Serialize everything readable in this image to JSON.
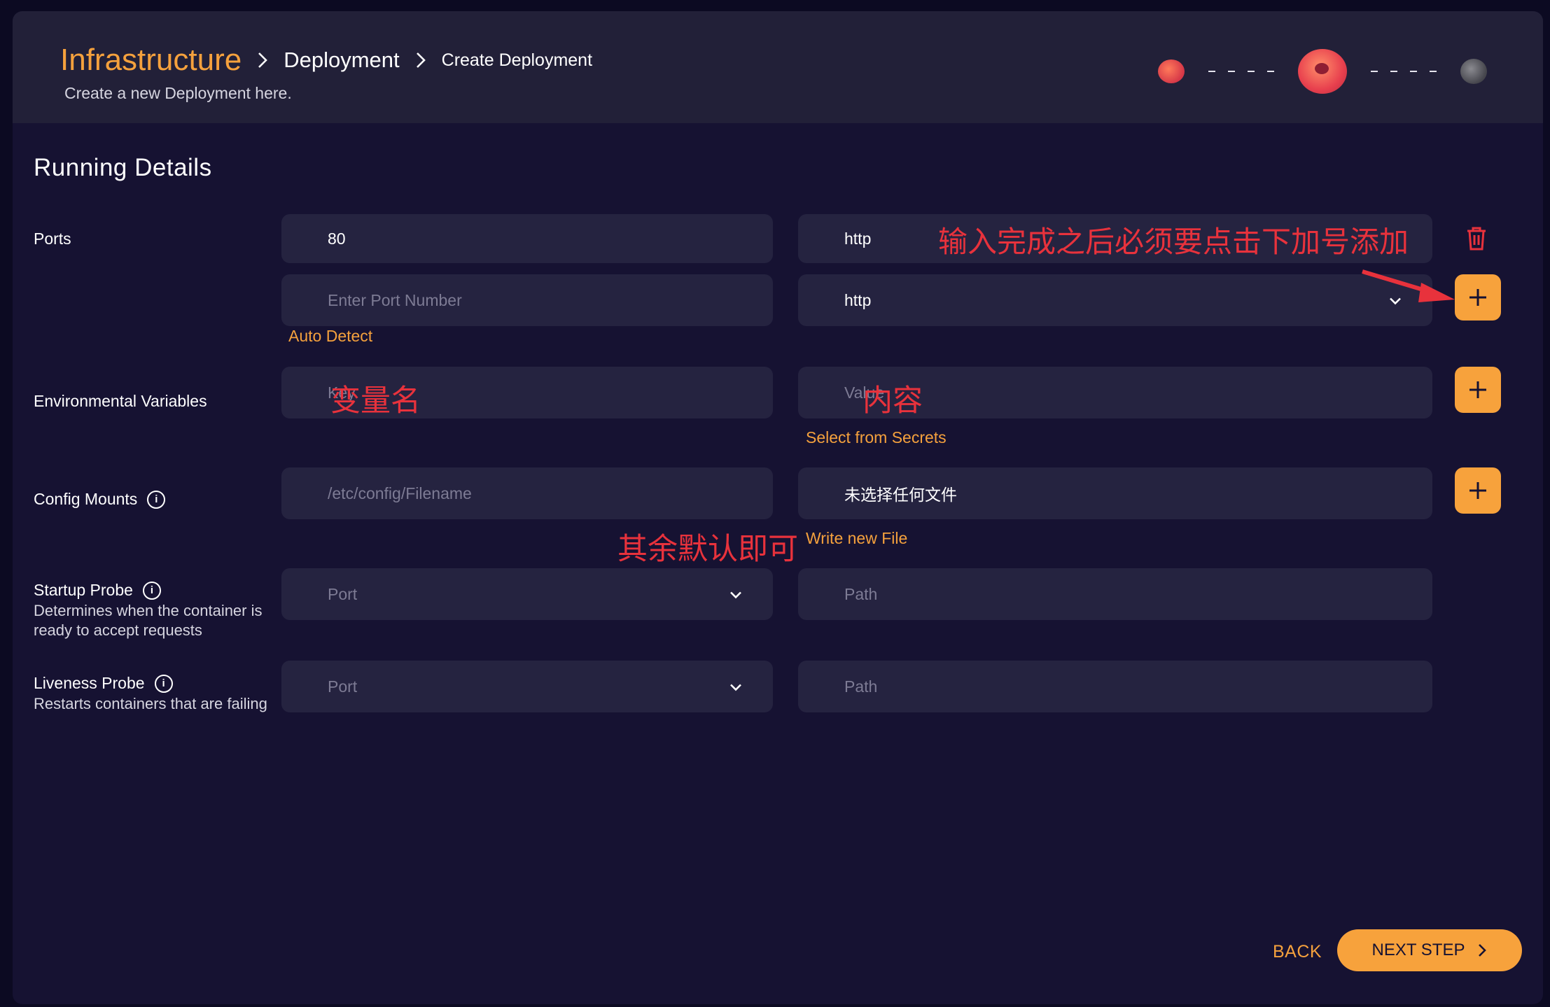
{
  "header": {
    "breadcrumb": [
      "Infrastructure",
      "Deployment",
      "Create Deployment"
    ],
    "subtitle": "Create a new Deployment here."
  },
  "section_title": "Running Details",
  "ports": {
    "label": "Ports",
    "existing_port": "80",
    "existing_protocol": "http",
    "port_placeholder": "Enter Port Number",
    "protocol_selected": "http",
    "auto_detect": "Auto Detect"
  },
  "env": {
    "label": "Environmental Variables",
    "key_placeholder": "Key",
    "value_placeholder": "Value",
    "secrets_link": "Select from Secrets"
  },
  "config": {
    "label": "Config Mounts",
    "path_placeholder": "/etc/config/Filename",
    "file_status": "未选择任何文件",
    "write_link": "Write new File"
  },
  "startup_probe": {
    "label": "Startup Probe",
    "description": "Determines when the container is ready to accept requests",
    "port_placeholder": "Port",
    "path_placeholder": "Path"
  },
  "liveness_probe": {
    "label": "Liveness Probe",
    "description": "Restarts containers that are failing",
    "port_placeholder": "Port",
    "path_placeholder": "Path"
  },
  "annotations": {
    "plus_hint": "输入完成之后必须要点击下加号添加",
    "key_hint": "变量名",
    "value_hint": "内容",
    "default_hint": "其余默认即可"
  },
  "footer": {
    "back": "BACK",
    "next": "NEXT STEP"
  },
  "colors": {
    "accent": "#f7a23c",
    "background": "#161232",
    "field": "#252340",
    "annotation": "#e8323c"
  },
  "icons": [
    "chevron-right-icon",
    "chevron-down-icon",
    "info-icon",
    "trash-icon",
    "plus-icon"
  ]
}
